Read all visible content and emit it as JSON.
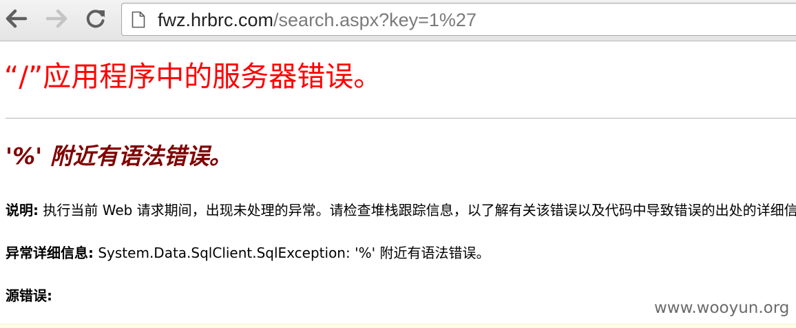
{
  "browser": {
    "url_host": "fwz.hrbrc.com",
    "url_path": "/search.aspx?key=1%27"
  },
  "page": {
    "title": "“/”应用程序中的服务器错误。",
    "subtitle": "'%' 附近有语法错误。",
    "description_label": "说明:",
    "description_text": " 执行当前 Web 请求期间，出现未处理的异常。请检查堆栈跟踪信息，以了解有关该错误以及代码中导致错误的出处的详细信息。",
    "exception_label": "异常详细信息:",
    "exception_text": " System.Data.SqlClient.SqlException: '%' 附近有语法错误。",
    "source_label": "源错误:"
  },
  "watermark": "www.wooyun.org",
  "icons": {
    "back": "back-arrow-icon",
    "forward": "forward-arrow-icon",
    "reload": "reload-icon",
    "page": "page-document-icon"
  },
  "colors": {
    "title": "#ff0000",
    "subtitle": "#800000",
    "url_path": "#7a7a7a"
  }
}
